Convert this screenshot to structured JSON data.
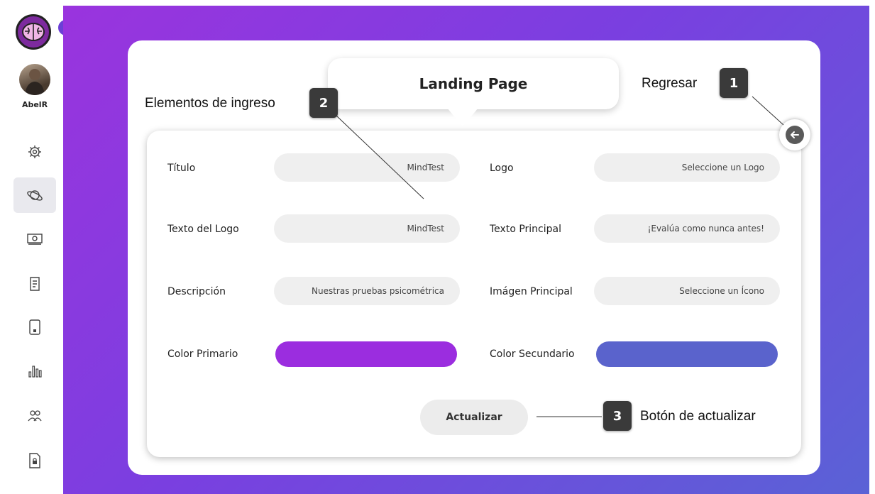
{
  "sidebar": {
    "username": "AbelR",
    "items": [
      {
        "name": "settings",
        "icon": "gear-icon"
      },
      {
        "name": "planet",
        "icon": "planet-icon"
      },
      {
        "name": "money",
        "icon": "money-icon"
      },
      {
        "name": "document",
        "icon": "document-icon"
      },
      {
        "name": "tablet",
        "icon": "tablet-icon"
      },
      {
        "name": "stats",
        "icon": "bar-chart-icon"
      },
      {
        "name": "users",
        "icon": "users-icon"
      },
      {
        "name": "file-lock",
        "icon": "file-lock-icon"
      }
    ]
  },
  "header": {
    "title": "Landing Page"
  },
  "form": {
    "titulo_label": "Título",
    "titulo_value": "MindTest",
    "logo_label": "Logo",
    "logo_value": "Seleccione un Logo",
    "texto_logo_label": "Texto del Logo",
    "texto_logo_value": "MindTest",
    "texto_principal_label": "Texto Principal",
    "texto_principal_value": "¡Evalúa como nunca antes!",
    "descripcion_label": "Descripción",
    "descripcion_value": "Nuestras pruebas psicométrica",
    "imagen_principal_label": "Imágen Principal",
    "imagen_principal_value": "Seleccione un Ícono",
    "color_primario_label": "Color Primario",
    "color_primario": "#9b2ddf",
    "color_secundario_label": "Color Secundario",
    "color_secundario": "#5a63cc",
    "update_label": "Actualizar"
  },
  "callouts": {
    "c1_num": "1",
    "c1_text": "Regresar",
    "c2_num": "2",
    "c2_text": "Elementos de ingreso",
    "c3_num": "3",
    "c3_text": "Botón de actualizar"
  }
}
